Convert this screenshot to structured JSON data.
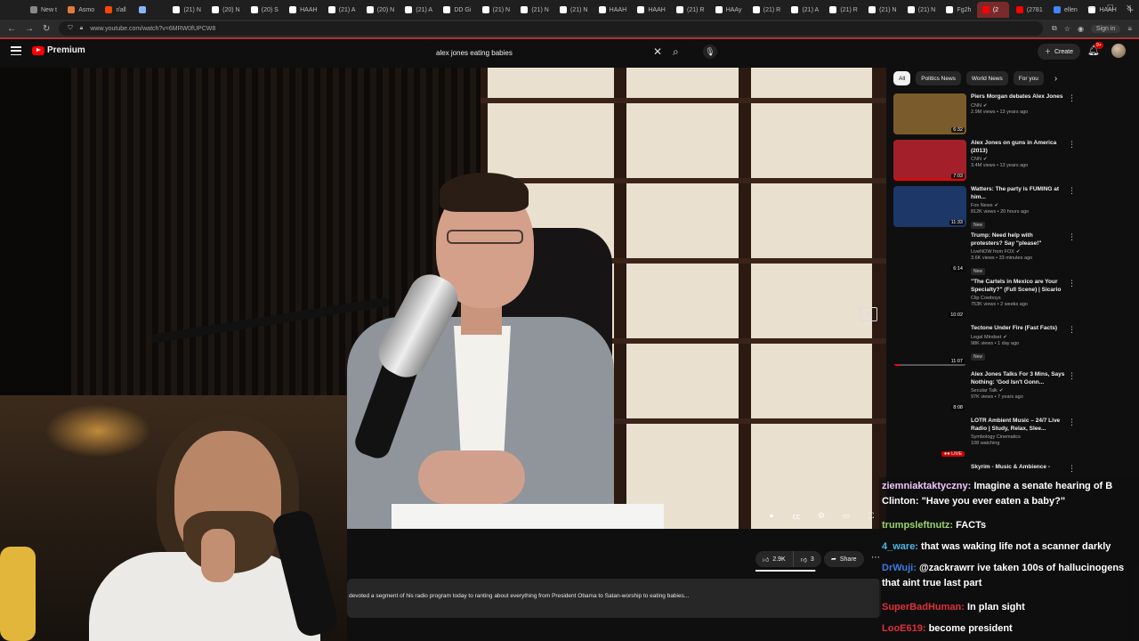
{
  "browser": {
    "tabs": [
      {
        "label": "New t",
        "color": "#888888"
      },
      {
        "label": "Asmo",
        "color": "#e07b39"
      },
      {
        "label": "r/all",
        "color": "#ff4500"
      },
      {
        "label": "",
        "color": "#8ab4f8"
      },
      {
        "label": "(21) N",
        "color": "#ffffff"
      },
      {
        "label": "(20) N",
        "color": "#ffffff"
      },
      {
        "label": "(20) S",
        "color": "#ffffff"
      },
      {
        "label": "HAAH",
        "color": "#ffffff"
      },
      {
        "label": "(21) A",
        "color": "#ffffff"
      },
      {
        "label": "(20) N",
        "color": "#ffffff"
      },
      {
        "label": "(21) A",
        "color": "#ffffff"
      },
      {
        "label": "DD Gi",
        "color": "#ffffff"
      },
      {
        "label": "(21) N",
        "color": "#ffffff"
      },
      {
        "label": "(21) N",
        "color": "#ffffff"
      },
      {
        "label": "(21) N",
        "color": "#ffffff"
      },
      {
        "label": "HAAH",
        "color": "#ffffff"
      },
      {
        "label": "HAAH",
        "color": "#ffffff"
      },
      {
        "label": "(21) R",
        "color": "#ffffff"
      },
      {
        "label": "HAAy",
        "color": "#ffffff"
      },
      {
        "label": "(21) R",
        "color": "#ffffff"
      },
      {
        "label": "(21) A",
        "color": "#ffffff"
      },
      {
        "label": "(21) R",
        "color": "#ffffff"
      },
      {
        "label": "(21) N",
        "color": "#ffffff"
      },
      {
        "label": "(21) N",
        "color": "#ffffff"
      },
      {
        "label": "Fg2h",
        "color": "#ffffff"
      },
      {
        "label": "(2",
        "color": "#ff0000",
        "active": true
      },
      {
        "label": "(2781",
        "color": "#ff0000"
      },
      {
        "label": "ellen",
        "color": "#4285f4"
      },
      {
        "label": "HAAH",
        "color": "#ffffff"
      }
    ],
    "url": "www.youtube.com/watch?v=6MRW0fUPCW8",
    "sign_in": "Sign in"
  },
  "youtube": {
    "logo_text": "Premium",
    "search_query": "alex jones eating babies",
    "create_label": "Create",
    "notifications_badge": "9+"
  },
  "video": {
    "likes": "2.9K",
    "dislikes": "3",
    "share_label": "Share",
    "like_ratio": 0.99,
    "description": "devoted a segment of his radio program today to ranting about everything from President Obama to Satan-worship to eating babies..."
  },
  "chips": [
    {
      "label": "All",
      "active": true
    },
    {
      "label": "Politics News",
      "active": false
    },
    {
      "label": "World News",
      "active": false
    },
    {
      "label": "For you",
      "active": false
    }
  ],
  "recommendations": [
    {
      "title": "Piers Morgan debates Alex Jones",
      "channel": "CNN",
      "verified": true,
      "views": "2.9M views • 13 years ago",
      "duration": "6:32",
      "new": false,
      "live": false,
      "thumb": "#7a5b2c",
      "progress": 0
    },
    {
      "title": "Alex Jones on guns in America (2013)",
      "channel": "CNN",
      "verified": true,
      "views": "3.4M views • 13 years ago",
      "duration": "7:03",
      "new": false,
      "live": false,
      "thumb": "#a3202a",
      "progress": 1.0
    },
    {
      "title": "Watters: The party is FUMING at him...",
      "channel": "Fox News",
      "verified": true,
      "views": "812K views • 20 hours ago",
      "duration": "11:33",
      "new": true,
      "live": false,
      "thumb": "#1d3868",
      "progress": 0
    },
    {
      "title": "Trump: Need help with protesters? Say \"please!\"",
      "channel": "LiveNOW from FOX",
      "verified": true,
      "views": "3.6K views • 33 minutes ago",
      "duration": "6:14",
      "new": true,
      "live": false,
      "thumb": "#0f0f0f",
      "progress": 0
    },
    {
      "title": "\"The Cartels in Mexico are Your Specialty?\" (Full Scene) | Sicario",
      "channel": "Clip Cowboys",
      "verified": false,
      "views": "753K views • 2 weeks ago",
      "duration": "10:02",
      "new": false,
      "live": false,
      "thumb": "#0f0f0f",
      "progress": 0
    },
    {
      "title": "Tectone Under Fire (Fast Facts)",
      "channel": "Legal Mindset",
      "verified": true,
      "views": "98K views • 1 day ago",
      "duration": "11:07",
      "new": true,
      "live": false,
      "thumb": "#0f0f0f",
      "progress": 0.08
    },
    {
      "title": "Alex Jones Talks For 3 Mins, Says Nothing: 'God Isn't Gonn...",
      "channel": "Secular Talk",
      "verified": true,
      "views": "97K views • 7 years ago",
      "duration": "8:08",
      "new": false,
      "live": false,
      "thumb": "#0f0f0f",
      "progress": 0
    },
    {
      "title": "LOTR Ambient Music – 24/7 Live Radio | Study, Relax, Slee...",
      "channel": "Symbology Cinematics",
      "verified": false,
      "views": "108 watching",
      "duration": "",
      "new": false,
      "live": true,
      "live_label": "LIVE",
      "thumb": "#0f0f0f",
      "progress": 0
    },
    {
      "title": "Skyrim - Music & Ambience -",
      "channel": "",
      "verified": false,
      "views": "",
      "duration": "",
      "new": false,
      "live": false,
      "thumb": "#0f0f0f",
      "progress": 0
    }
  ],
  "labels": {
    "new": "New",
    "verified_mark": "✔"
  },
  "chat": [
    {
      "user": "ziemniaktaktyczny:",
      "text": "Imagine a senate hearing of B Clinton: \"Have you ever eaten a baby?\"",
      "color": "#f1c6ff"
    },
    {
      "user": "trumpsleftnutz:",
      "text": "FACTs",
      "color": "#9bd36a"
    },
    {
      "user": "4_ware:",
      "text": "that was waking life not a scanner darkly",
      "color": "#4fb6e8"
    },
    {
      "user": "DrWuji:",
      "text": "@zackrawrr ive taken 100s of hallucinogens that aint true last part",
      "color": "#3f7ae0"
    },
    {
      "user": "SuperBadHuman:",
      "text": "In plan sight",
      "color": "#e0323c"
    },
    {
      "user": "LooE619:",
      "text": "become president",
      "color": "#e0323c"
    }
  ]
}
